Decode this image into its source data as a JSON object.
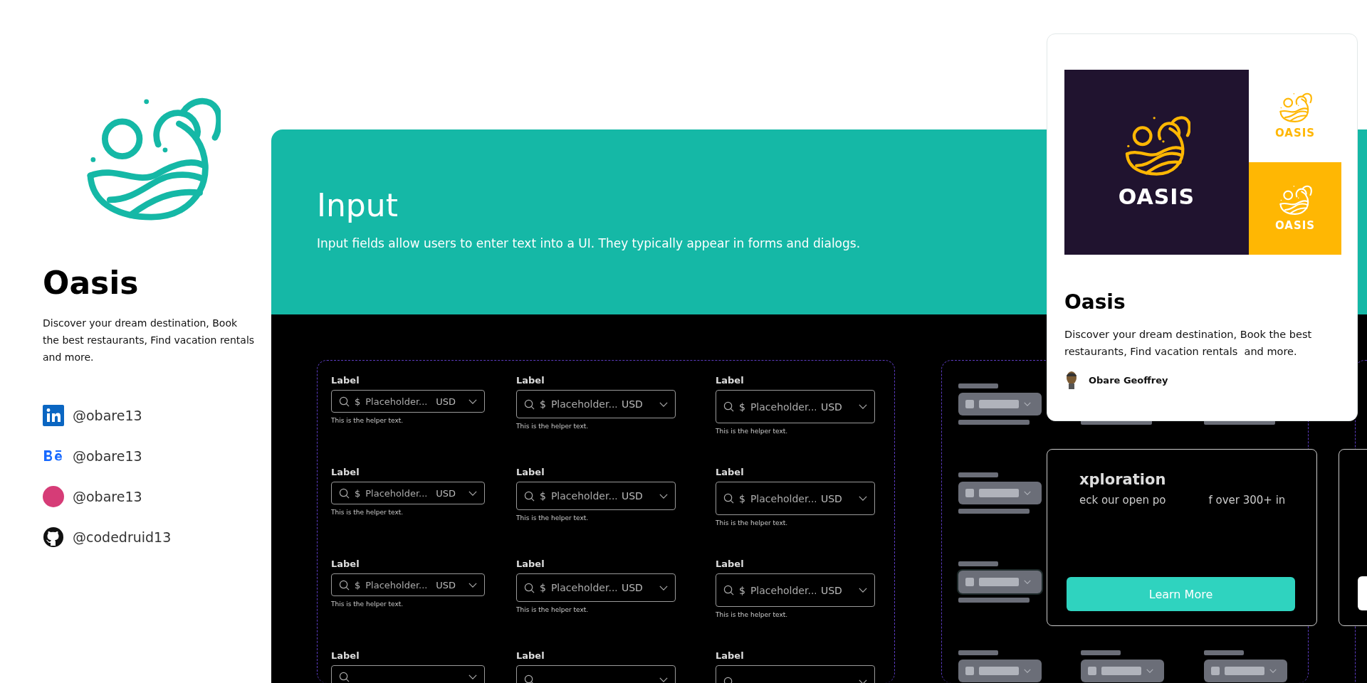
{
  "sidebar": {
    "title": "Oasis",
    "description": "Discover your dream destination, Book the best restaurants, Find vacation rentals  and more.",
    "socials": [
      {
        "kind": "linkedin",
        "handle": "@obare13"
      },
      {
        "kind": "behance",
        "handle": "@obare13"
      },
      {
        "kind": "dribbble",
        "handle": "@obare13"
      },
      {
        "kind": "github",
        "handle": "@codedruid13"
      }
    ]
  },
  "header": {
    "title": "Input",
    "subtitle": "Input fields allow users to enter text into a UI. They typically appear in forms and dialogs."
  },
  "input_grid": {
    "rows": [
      [
        {
          "kind": "sm",
          "label": "Label",
          "prefix": "$",
          "placeholder": "Placeholder...",
          "suffix": "USD",
          "helper": "This is the helper text."
        },
        {
          "kind": "md",
          "label": "Label",
          "prefix": "$",
          "placeholder": "Placeholder...",
          "suffix": "USD",
          "helper": "This is the helper text."
        },
        {
          "kind": "lg",
          "label": "Label",
          "prefix": "$",
          "placeholder": "Placeholder...",
          "suffix": "USD",
          "helper": "This is the helper text."
        }
      ],
      [
        {
          "kind": "sm",
          "label": "Label",
          "prefix": "$",
          "placeholder": "Placeholder...",
          "suffix": "USD",
          "helper": "This is the helper text."
        },
        {
          "kind": "md",
          "label": "Label",
          "prefix": "$",
          "placeholder": "Placeholder...",
          "suffix": "USD",
          "helper": "This is the helper text."
        },
        {
          "kind": "lg",
          "label": "Label",
          "prefix": "$",
          "placeholder": "Placeholder...",
          "suffix": "USD",
          "helper": "This is the helper text."
        }
      ],
      [
        {
          "kind": "sm",
          "label": "Label",
          "prefix": "$",
          "placeholder": "Placeholder...",
          "suffix": "USD",
          "helper": "This is the helper text."
        },
        {
          "kind": "md",
          "label": "Label",
          "prefix": "$",
          "placeholder": "Placeholder...",
          "suffix": "USD",
          "helper": "This is the helper text."
        },
        {
          "kind": "lg",
          "label": "Label",
          "prefix": "$",
          "placeholder": "Placeholder...",
          "suffix": "USD",
          "helper": "This is the helper text."
        }
      ],
      [
        {
          "kind": "sm",
          "label": "Label"
        },
        {
          "kind": "md",
          "label": "Label"
        },
        {
          "kind": "lg",
          "label": "Label"
        }
      ]
    ]
  },
  "preview_card": {
    "brand_tiles": [
      {
        "kind": "dark",
        "wordmark": "OASIS"
      },
      {
        "kind": "light",
        "wordmark": "OASIS"
      },
      {
        "kind": "yellow",
        "wordmark": "OASIS"
      }
    ],
    "title": "Oasis",
    "description": "Discover your dream destination, Book the best restaurants, Find vacation rentals  and more.",
    "author": "Obare Geoffrey"
  },
  "promo_card": {
    "heading": "xploration",
    "lines": [
      "eck our open po",
      "f over 300+ in"
    ],
    "button": "Learn More"
  }
}
